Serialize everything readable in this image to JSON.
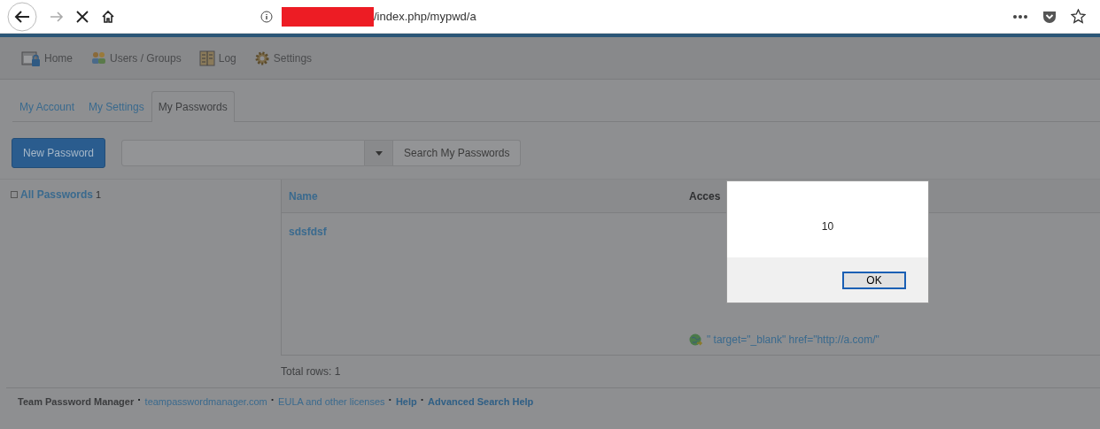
{
  "browser": {
    "url": "/index.php/mypwd/a"
  },
  "nav": [
    {
      "label": "Home",
      "kind": "home"
    },
    {
      "label": "Users / Groups",
      "kind": "users"
    },
    {
      "label": "Log",
      "kind": "log"
    },
    {
      "label": "Settings",
      "kind": "settings"
    }
  ],
  "tabs": [
    {
      "label": "My Account",
      "selected": false
    },
    {
      "label": "My Settings",
      "selected": false
    },
    {
      "label": "My Passwords",
      "selected": true
    }
  ],
  "toolbar": {
    "new_button": "New Password",
    "search_button": "Search My Passwords"
  },
  "sidebar": {
    "items": [
      {
        "label": "All Passwords",
        "count": "1"
      }
    ]
  },
  "table": {
    "columns": [
      "Name",
      "Acces"
    ],
    "rows": [
      {
        "name": "sdsfdsf",
        "access": "\" target=\"_blank\" href=\"http://a.com/\""
      }
    ]
  },
  "total": "Total rows: 1",
  "footer": {
    "separator": "·",
    "items": [
      {
        "text": "Team Password Manager",
        "kind": "brand"
      },
      {
        "text": "teampasswordmanager.com",
        "kind": "link"
      },
      {
        "text": "EULA and other licenses",
        "kind": "link"
      },
      {
        "text": "Help",
        "kind": "bold-link"
      },
      {
        "text": "Advanced Search Help",
        "kind": "bold-link"
      }
    ]
  },
  "dialog": {
    "message": "10",
    "button": "OK"
  }
}
